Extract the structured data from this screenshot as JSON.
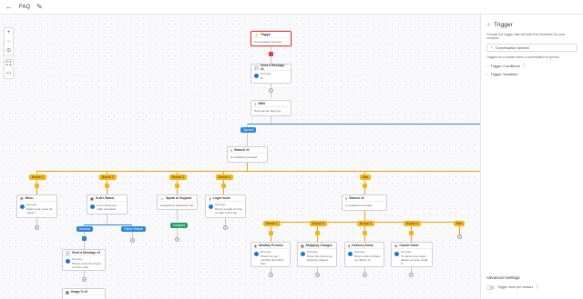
{
  "topbar": {
    "back_icon": "arrow-left-icon",
    "title": "FAQ",
    "edit_icon": "pencil-icon"
  },
  "zoom": {
    "zoom_in": "+",
    "zoom_out": "−",
    "fit": "⊙",
    "tool_a": "⌶⌶",
    "tool_b": "▭"
  },
  "nodes": {
    "trigger": {
      "title": "Trigger",
      "line1": "Conversation Opened"
    },
    "send1": {
      "title": "Send a Message #1",
      "lbl": "Message",
      "text": "Hi"
    },
    "nlu": {
      "title": "NNN",
      "text": "How can we help you"
    },
    "branch1": {
      "title": "Branch #1",
      "text": "6 conditions provided"
    },
    "menu": {
      "title": "Menu",
      "lbl": "Message",
      "text": "Select your menu for Ingram"
    },
    "order": {
      "title": "Order Status",
      "text": "Let's check your order via status"
    },
    "support": {
      "title": "Speak to Support",
      "text": "Assigned to Stephanie Tan"
    },
    "login": {
      "title": "Login Issue",
      "lbl": "Message",
      "text": "Here's a guide to how to login to the site"
    },
    "branch2": {
      "title": "Branch #2",
      "text": "4 conditions provided"
    },
    "send3": {
      "title": "Send a Message #3",
      "lbl": "Message",
      "text": "Please enter the ID get to track order"
    },
    "image": {
      "title": "Image %-#1"
    },
    "monthly": {
      "title": "Monthly Promos",
      "lbl": "Message",
      "text": "Check out our monthly promotion here"
    },
    "shipping": {
      "title": "Shipping Charges",
      "lbl": "Message",
      "text": "Here's the link to our shipping charges"
    },
    "delivery": {
      "title": "Delivery Areas",
      "lbl": "Message",
      "text": "Here's a list of where we deliver to"
    },
    "cancel": {
      "title": "Cancel Order",
      "lbl": "Message",
      "text": "To cancel your order please send an email to"
    }
  },
  "chips": {
    "opened": "Opened",
    "b1": "Branch 1",
    "b2": "Branch 2",
    "b3": "Branch 3",
    "b4": "Branch 4",
    "else1": "Else",
    "success": "Success",
    "failure": "Failure Branch",
    "assign": "Assigned",
    "c1": "Branch 1",
    "c2": "Branch 2",
    "c3": "Branch 3",
    "c4": "Branch 4",
    "else2": "Else"
  },
  "panel": {
    "title": "Trigger",
    "title_icon": "sparkle-icon",
    "description": "Choose the trigger that will start this Workflow for your contacts.",
    "selected": "Conversation Opened",
    "note": "Triggers for a contact when a conversation is opened",
    "conditions": "Trigger Conditions",
    "variables": "Trigger Variables",
    "advanced": "Advanced Settings",
    "toggle_label": "Trigger once per contact"
  },
  "colors": {
    "accent": "#2a87d6",
    "branch": "#f5b519",
    "active": "#e03a3a",
    "success": "#1fa05d"
  }
}
